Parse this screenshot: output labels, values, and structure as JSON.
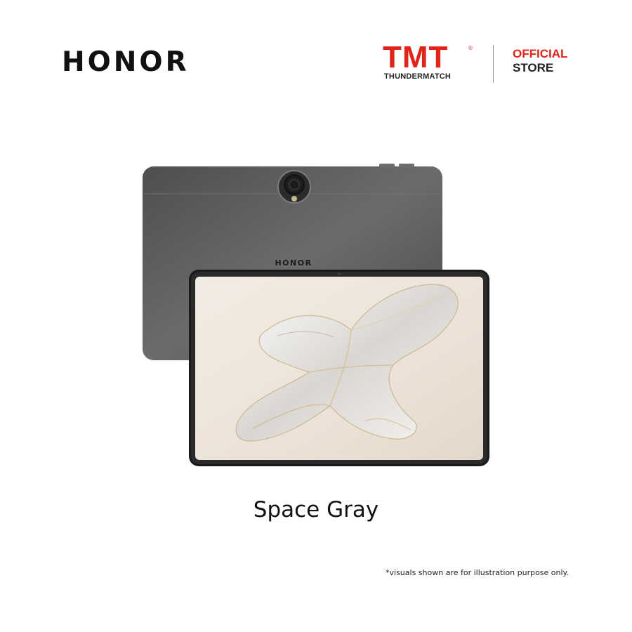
{
  "header": {
    "brand": "HONOR",
    "retailer_logo_text": "TMT",
    "retailer_trademark": "®",
    "retailer_name": "THUNDERMATCH",
    "store_line1": "OFFICIAL",
    "store_line2": "STORE"
  },
  "product": {
    "back_logo": "HONOR",
    "color_name": "Space Gray"
  },
  "footer": {
    "disclaimer": "*visuals shown are for illustration purpose only."
  },
  "colors": {
    "brand_red": "#e2231a",
    "tablet_body": "#5b5c5e",
    "screen_bg": "#efe6dc"
  }
}
